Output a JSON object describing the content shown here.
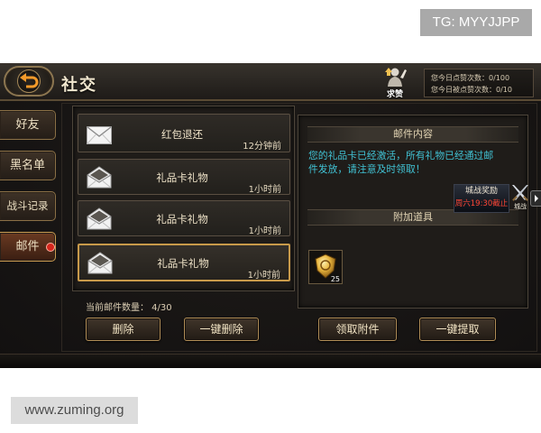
{
  "watermarks": {
    "top_right": "TG: MYYJJPP",
    "bottom_left": "www.zuming.org"
  },
  "header": {
    "title": "社交",
    "back_icon": "back-arrow-icon",
    "like_button": {
      "label": "求赞",
      "icon": "thumbs-up-figure-icon"
    },
    "stats": [
      "您今日点赞次数：0/100",
      "您今日被点赞次数：0/10"
    ]
  },
  "sidebar": {
    "tabs": [
      {
        "label": "好友",
        "selected": false
      },
      {
        "label": "黑名单",
        "selected": false
      },
      {
        "label": "战斗记录",
        "selected": false
      },
      {
        "label": "邮件",
        "selected": true,
        "has_unread_badge": true
      }
    ]
  },
  "mail_list": {
    "items": [
      {
        "title": "红包退还",
        "time": "12分钟前",
        "icon": "closed-envelope-icon",
        "selected": false
      },
      {
        "title": "礼品卡礼物",
        "time": "1小时前",
        "icon": "open-envelope-icon",
        "selected": false
      },
      {
        "title": "礼品卡礼物",
        "time": "1小时前",
        "icon": "open-envelope-icon",
        "selected": false
      },
      {
        "title": "礼品卡礼物",
        "time": "1小时前",
        "icon": "open-envelope-icon",
        "selected": true
      }
    ],
    "count_text": "当前邮件数量： 4/30",
    "buttons": {
      "delete": "删除",
      "delete_all": "一键删除"
    }
  },
  "mail_detail": {
    "content_header": "邮件内容",
    "content_text": "您的礼品卡已经激活，所有礼物已经通过邮件发放，请注意及时领取！",
    "attachment_header": "附加道具",
    "attachments": [
      {
        "icon": "gold-medal-icon",
        "quantity": "25"
      }
    ],
    "buttons": {
      "claim": "领取附件",
      "claim_all": "一键提取"
    }
  },
  "event_popup": {
    "title": "城战奖励",
    "deadline": "周六19:30截止",
    "icon": "crossed-swords-icon",
    "icon_label": "城战"
  },
  "colors": {
    "content_text": "#41c2d4",
    "deadline_text": "#ff4535",
    "mail_badge": "#d6261c",
    "selected_border": "#c89a4a",
    "button_text": "#f2e4c4"
  }
}
